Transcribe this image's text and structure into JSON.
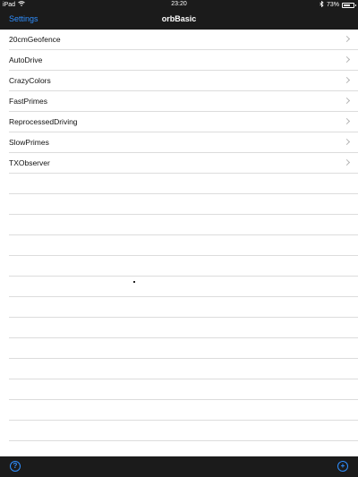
{
  "status_bar": {
    "device": "iPad",
    "time": "23:20",
    "battery": "73%",
    "battery_level": 0.73
  },
  "nav": {
    "back_label": "Settings",
    "title": "orbBasic"
  },
  "programs": [
    {
      "label": "20cmGeofence"
    },
    {
      "label": "AutoDrive"
    },
    {
      "label": "CrazyColors"
    },
    {
      "label": "FastPrimes"
    },
    {
      "label": "ReprocessedDriving"
    },
    {
      "label": "SlowPrimes"
    },
    {
      "label": "TXObserver"
    }
  ],
  "toolbar": {
    "help_glyph": "?",
    "add_glyph": "+"
  },
  "colors": {
    "bar_background": "#1b1b1b",
    "accent": "#2f8fff"
  }
}
